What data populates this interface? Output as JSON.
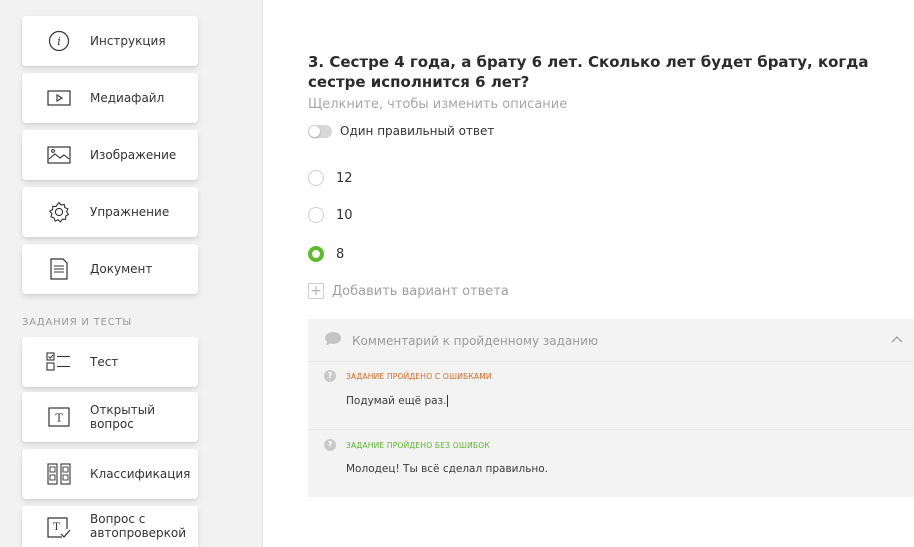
{
  "sidebar": {
    "items": [
      {
        "label": "Инструкция",
        "icon": "info-icon"
      },
      {
        "label": "Медиафайл",
        "icon": "media-play-icon"
      },
      {
        "label": "Изображение",
        "icon": "image-icon"
      },
      {
        "label": "Упражнение",
        "icon": "gear-icon"
      },
      {
        "label": "Документ",
        "icon": "document-icon"
      }
    ],
    "section_label": "ЗАДАНИЯ И ТЕСТЫ",
    "test_items": [
      {
        "label": "Тест",
        "icon": "checklist-icon"
      },
      {
        "label": "Открытый вопрос",
        "label_line1": "Открытый",
        "label_line2": "вопрос",
        "icon": "text-box-icon"
      },
      {
        "label": "Классификация",
        "icon": "classification-icon"
      },
      {
        "label": "Вопрос с автопроверкой",
        "label_line1": "Вопрос с",
        "label_line2": "автопроверкой",
        "icon": "autocheck-icon"
      }
    ]
  },
  "question": {
    "title": "3. Сестре 4 года, а брату 6 лет. Сколько лет будет брату, когда сестре исполнится 6 лет?",
    "description_placeholder": "Щелкните, чтобы изменить описание",
    "single_answer_label": "Один правильный ответ",
    "single_answer_enabled": false,
    "options": [
      {
        "label": "12",
        "checked": false
      },
      {
        "label": "10",
        "checked": false
      },
      {
        "label": "8",
        "checked": true
      }
    ],
    "add_option_label": "Добавить вариант ответа"
  },
  "comment": {
    "header": "Комментарий к пройденному заданию",
    "error_badge": "ЗАДАНИЕ ПРОЙДЕНО С ОШИБКАМИ",
    "error_text": "Подумай ещё раз.",
    "ok_badge": "ЗАДАНИЕ ПРОЙДЕНО БЕЗ ОШИБОК",
    "ok_text": "Молодец! Ты всё сделал правильно."
  },
  "colors": {
    "accent_green": "#5bbd28",
    "error_orange": "#e2661f",
    "sidebar_bg": "#f2f2f2"
  }
}
